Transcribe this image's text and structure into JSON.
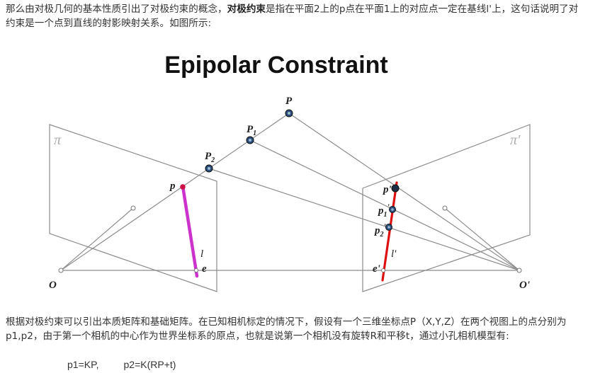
{
  "paragraph1": {
    "before": "那么由对极几何的基本性质引出了对极约束的概念，",
    "bold": "对极约束",
    "after": "是指在平面2上的p点在平面1上的对应点一定在基线l'上，这句话说明了对",
    "line2": "约束是一个点到直线的射影映射关系。如图所示:"
  },
  "figure": {
    "title": "Epipolar Constraint",
    "labels": {
      "P": "P",
      "P1": "P",
      "P1_sub": "1",
      "P2": "P",
      "P2_sub": "2",
      "plane_left": "π",
      "plane_right": "π'",
      "p_left": "p",
      "l_left": "l",
      "e_left": "e",
      "O_left": "O",
      "p_right": "p'",
      "p1_right": "p",
      "p1_right_sub": "1",
      "p1_right_prime": "'",
      "p2_right": "p",
      "p2_right_sub": "2",
      "p2_right_prime": "'",
      "l_right": "l'",
      "e_right": "e'",
      "O_right": "O'"
    },
    "colors": {
      "line": "#8c8c8c",
      "epipolar_left": "#cc33cc",
      "epipolar_right": "#dd1111",
      "point_fill": "#2b4f7a"
    }
  },
  "paragraph2": {
    "line1": "根据对极约束可以引出本质矩阵和基础矩阵。在已知相机标定的情况下，假设有一个三维坐标点P（X,Y,Z）在两个视图上的点分别为",
    "line2": "p1,p2，由于第一个相机的中心作为世界坐标系的原点，也就是说第一个相机没有旋转R和平移t，通过小孔相机模型有:"
  },
  "formula": "p1=KP,         p2=K(RP+t)"
}
